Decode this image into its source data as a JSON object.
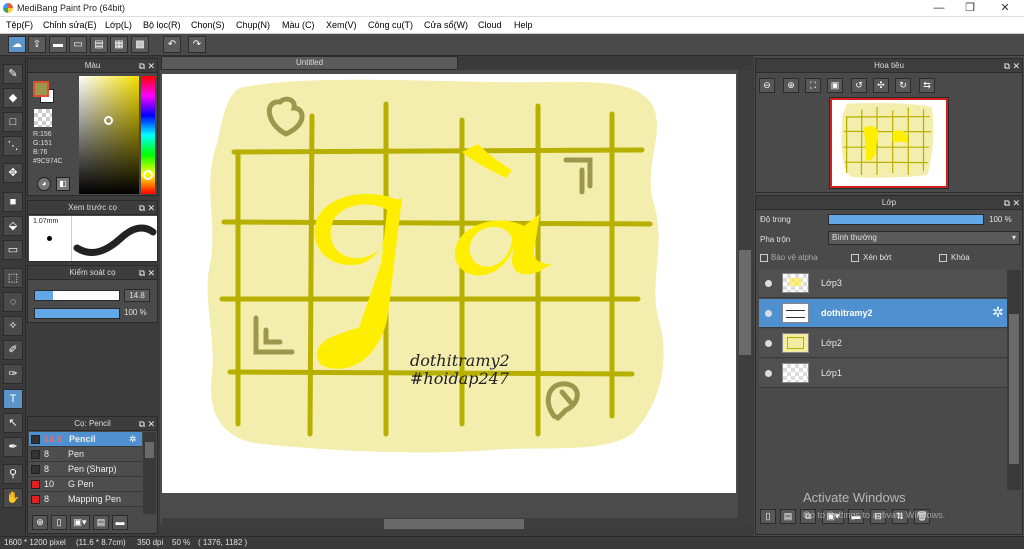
{
  "window": {
    "title": "MediBang Paint Pro (64bit)",
    "controls": [
      "—",
      "❐",
      "✕"
    ]
  },
  "menu": [
    "Tệp(F)",
    "Chỉnh sửa(E)",
    "Lớp(L)",
    "Bộ lọc(R)",
    "Chọn(S)",
    "Chụp(N)",
    "Màu (C)",
    "Xem(V)",
    "Công cụ(T)",
    "Cửa sổ(W)",
    "Cloud",
    "Help"
  ],
  "color_panel": {
    "title": "Màu",
    "rgb": {
      "r": "R:156",
      "g": "G:151",
      "b": "B:76"
    },
    "hex": "#9C974C",
    "fg_color": "#9c974c",
    "bg_color": "#ffffff"
  },
  "brush_preview": {
    "title": "Xem trước cọ",
    "size": "1.07mm"
  },
  "brush_control": {
    "title": "Kiểm soát cọ",
    "size_value": "14.8",
    "size_fraction": 0.22,
    "opacity_value": "100 %",
    "opacity_fraction": 1.0
  },
  "brush_list": {
    "title": "Cọ: Pencil",
    "items": [
      {
        "size": "14.8",
        "name": "Pencil",
        "color": "#333333"
      },
      {
        "size": "8",
        "name": "Pen",
        "color": "#333333"
      },
      {
        "size": "8",
        "name": "Pen (Sharp)",
        "color": "#333333"
      },
      {
        "size": "10",
        "name": "G Pen",
        "color": "#e02020"
      },
      {
        "size": "8",
        "name": "Mapping Pen",
        "color": "#e02020"
      }
    ]
  },
  "canvas": {
    "tab_title": "Untitled",
    "text_line1": "dothitramy2",
    "text_line2": "#hoidap247",
    "big_text": "gà"
  },
  "navigator": {
    "title": "Hoa tiêu"
  },
  "layers": {
    "title": "Lớp",
    "opacity_label": "Độ trong",
    "opacity_value": "100 %",
    "opacity_fraction": 1.0,
    "blend_label": "Pha trộn",
    "blend_value": "Bình thường",
    "protect_alpha": "Bảo vệ alpha",
    "clipping": "Xén bớt",
    "lock": "Khóa",
    "items": [
      {
        "name": "Lớp3",
        "selected": false
      },
      {
        "name": "dothitramy2",
        "selected": true
      },
      {
        "name": "Lớp2",
        "selected": false
      },
      {
        "name": "Lớp1",
        "selected": false
      }
    ]
  },
  "watermark": {
    "line1": "Activate Windows",
    "line2": "Go to Settings to activate Windows."
  },
  "status": {
    "size": "1600 * 1200 pixel",
    "cm": "(11.6 * 8.7cm)",
    "dpi": "350 dpi",
    "zoom": "50 %",
    "coords": "( 1376, 1182 )"
  },
  "colors": {
    "accent": "#4f91d0",
    "grid": "#b8b000",
    "blob": "#f3eeae",
    "yellow": "#ffee00",
    "olive": "#9c974c"
  }
}
